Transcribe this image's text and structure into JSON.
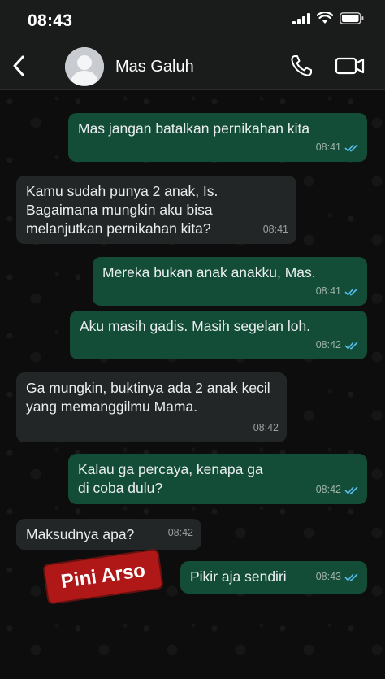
{
  "status_bar": {
    "time": "08:43",
    "icons": [
      "signal-icon",
      "wifi-icon",
      "battery-icon"
    ]
  },
  "header": {
    "contact_name": "Mas Galuh",
    "icons": [
      "back-chevron-icon",
      "avatar-icon",
      "phone-icon",
      "video-camera-icon"
    ]
  },
  "messages": [
    {
      "direction": "out",
      "text": "Mas jangan batalkan pernikahan kita",
      "time": "08:41",
      "read": true
    },
    {
      "direction": "in",
      "text": "Kamu sudah punya 2 anak, Is. Bagaimana mungkin aku bisa melanjutkan pernikahan kita?",
      "time": "08:41"
    },
    {
      "direction": "out",
      "text": "Mereka bukan anak anakku, Mas.",
      "time": "08:41",
      "read": true
    },
    {
      "direction": "out",
      "text": "Aku masih gadis. Masih segelan loh.",
      "time": "08:42",
      "read": true
    },
    {
      "direction": "in",
      "text": "Ga mungkin, buktinya ada 2 anak kecil yang memanggilmu Mama.",
      "time": "08:42"
    },
    {
      "direction": "out",
      "text": "Kalau ga percaya, kenapa ga di coba dulu?",
      "time": "08:42",
      "read": true
    },
    {
      "direction": "in",
      "text": "Maksudnya apa?",
      "time": "08:42"
    },
    {
      "direction": "out",
      "text": "Pikir aja sendiri",
      "time": "08:43",
      "read": true
    }
  ],
  "watermark": {
    "text": "Pini Arso"
  },
  "colors": {
    "outgoing_bubble": "#144d37",
    "incoming_bubble": "#232626",
    "read_ticks": "#53bdeb",
    "watermark_bg": "#b01818"
  }
}
